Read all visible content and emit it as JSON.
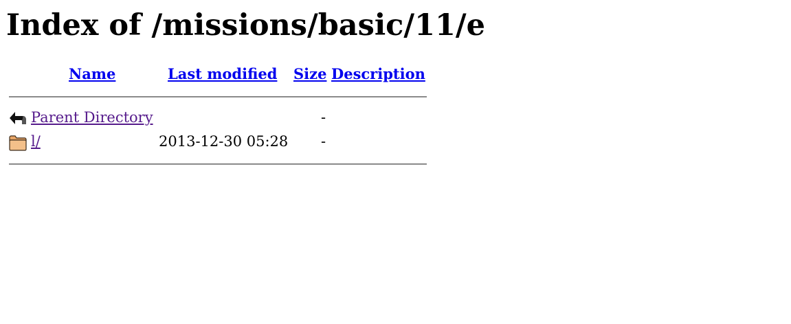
{
  "title": "Index of /missions/basic/11/e",
  "columns": {
    "name": "Name",
    "last_modified": "Last modified",
    "size": "Size",
    "description": "Description"
  },
  "rows": [
    {
      "icon": "back-arrow-icon",
      "name": "Parent Directory",
      "last_modified": "",
      "size": "-",
      "description": ""
    },
    {
      "icon": "folder-icon",
      "name": "l/",
      "last_modified": "2013-12-30 05:28",
      "size": "-",
      "description": ""
    }
  ],
  "colors": {
    "link": "#0000ee",
    "visited_link": "#551a8b",
    "rule": "#8a8a8a"
  }
}
